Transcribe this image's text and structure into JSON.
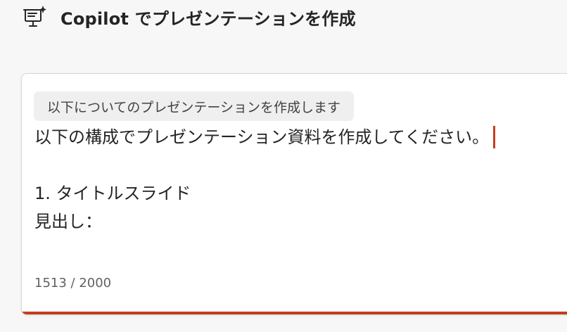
{
  "header": {
    "title": "Copilot でプレゼンテーションを作成",
    "icon": "presentation-sparkle-icon"
  },
  "prompt_chip": {
    "label": "以下についてのプレゼンテーションを作成します"
  },
  "editor": {
    "lines": [
      "以下の構成でプレゼンテーション資料を作成してください。",
      "",
      "1. タイトルスライド",
      "見出し："
    ]
  },
  "counter": {
    "text": "1513 / 2000"
  },
  "colors": {
    "accent": "#c43e1c",
    "background": "#f7f7f7",
    "card": "#ffffff",
    "chip": "#efefef"
  }
}
